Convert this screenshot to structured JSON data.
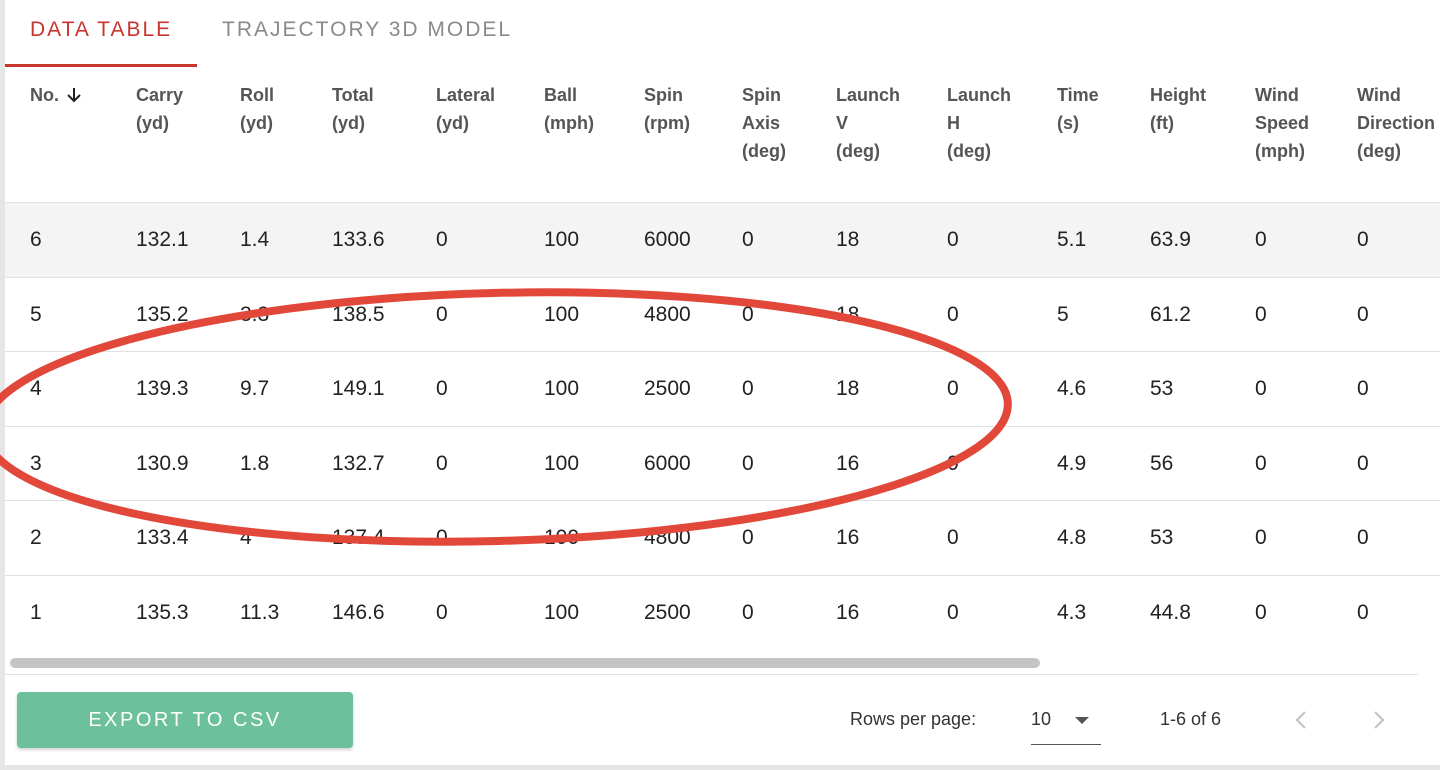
{
  "tabs": {
    "items": [
      {
        "label": "DATA TABLE",
        "active": true
      },
      {
        "label": "TRAJECTORY 3D MODEL",
        "active": false
      }
    ]
  },
  "colors": {
    "accent": "#c8352e",
    "export_button": "#6cc19c",
    "annotation": "#e2483a"
  },
  "table": {
    "sort_column": "No.",
    "sort_icon": "arrow-down-icon",
    "columns": [
      "No.",
      "Carry\n(yd)",
      "Roll\n(yd)",
      "Total\n(yd)",
      "Lateral\n(yd)",
      "Ball\n(mph)",
      "Spin\n(rpm)",
      "Spin\nAxis\n(deg)",
      "Launch\nV\n(deg)",
      "Launch\nH\n(deg)",
      "Time\n(s)",
      "Height\n(ft)",
      "Wind\nSpeed\n(mph)",
      "Wind\nDirection\n(deg)"
    ],
    "rows": [
      [
        "6",
        "132.1",
        "1.4",
        "133.6",
        "0",
        "100",
        "6000",
        "0",
        "18",
        "0",
        "5.1",
        "63.9",
        "0",
        "0"
      ],
      [
        "5",
        "135.2",
        "3.3",
        "138.5",
        "0",
        "100",
        "4800",
        "0",
        "18",
        "0",
        "5",
        "61.2",
        "0",
        "0"
      ],
      [
        "4",
        "139.3",
        "9.7",
        "149.1",
        "0",
        "100",
        "2500",
        "0",
        "18",
        "0",
        "4.6",
        "53",
        "0",
        "0"
      ],
      [
        "3",
        "130.9",
        "1.8",
        "132.7",
        "0",
        "100",
        "6000",
        "0",
        "16",
        "0",
        "4.9",
        "56",
        "0",
        "0"
      ],
      [
        "2",
        "133.4",
        "4",
        "137.4",
        "0",
        "100",
        "4800",
        "0",
        "16",
        "0",
        "4.8",
        "53",
        "0",
        "0"
      ],
      [
        "1",
        "135.3",
        "11.3",
        "146.6",
        "0",
        "100",
        "2500",
        "0",
        "16",
        "0",
        "4.3",
        "44.8",
        "0",
        "0"
      ]
    ],
    "highlighted_row": 0
  },
  "footer": {
    "export_label": "EXPORT TO CSV",
    "rows_per_page_label": "Rows per page:",
    "rows_per_page_value": "10",
    "range_text": "1-6 of 6",
    "prev_icon": "chevron-left-icon",
    "next_icon": "chevron-right-icon"
  }
}
